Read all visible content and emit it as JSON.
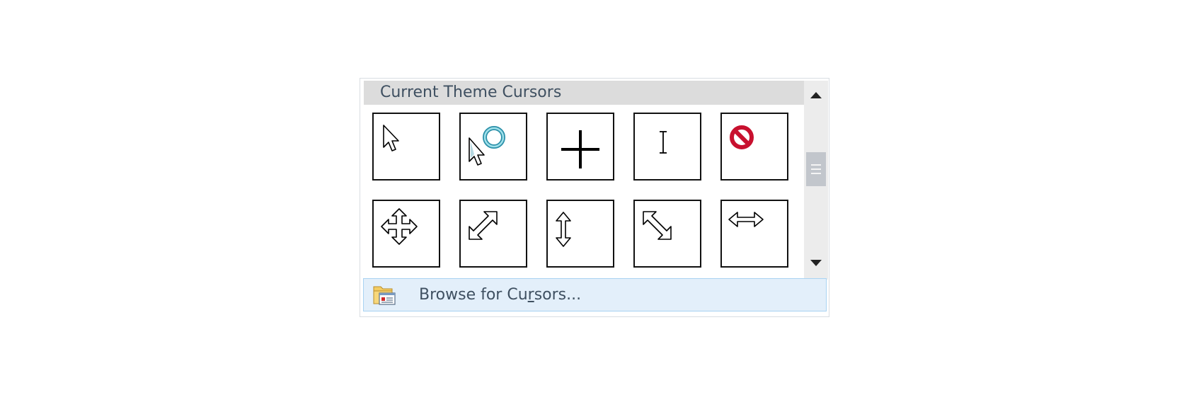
{
  "gallery": {
    "header": "Current Theme Cursors",
    "cursors": [
      {
        "icon": "normal-select-icon"
      },
      {
        "icon": "working-in-background-icon"
      },
      {
        "icon": "precision-select-icon"
      },
      {
        "icon": "text-select-icon"
      },
      {
        "icon": "unavailable-icon"
      },
      {
        "icon": "move-icon"
      },
      {
        "icon": "diagonal-resize-2-icon"
      },
      {
        "icon": "vertical-resize-icon"
      },
      {
        "icon": "diagonal-resize-1-icon"
      },
      {
        "icon": "horizontal-resize-icon"
      }
    ]
  },
  "scrollbar": {
    "up_icon": "triangle-up-icon",
    "down_icon": "triangle-down-icon",
    "thumb_icon": "grip-lines-icon"
  },
  "browse": {
    "label_before": "Browse for Cu",
    "label_mnemonic": "r",
    "label_after": "sors...",
    "icon": "folder-icon"
  },
  "colors": {
    "header_bg": "#dcdcdc",
    "text": "#3f5061",
    "browse_bg": "#e3effa",
    "browse_border": "#a9d3f2"
  }
}
